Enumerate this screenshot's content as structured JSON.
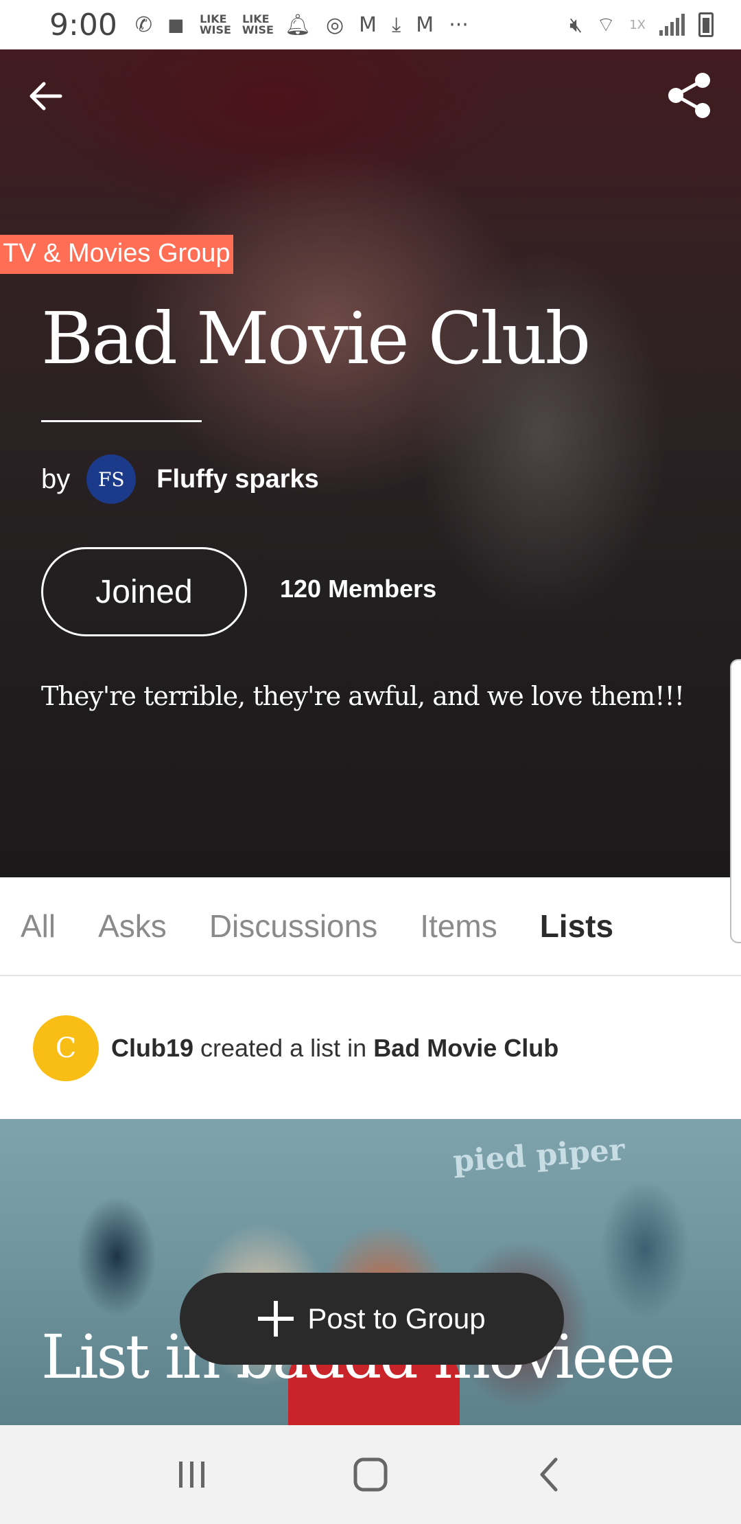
{
  "status_bar": {
    "time": "9:00",
    "left_icons": [
      "wifi-call-icon",
      "bag-icon",
      "like-wise-icon",
      "like-wise-icon",
      "bell-icon",
      "sync-icon",
      "gmail-icon",
      "download-icon",
      "gmail-icon",
      "more-icon"
    ],
    "like_wise_label": "LIKE WISE",
    "more_label": "···",
    "right_icons": [
      "mute-icon",
      "wifi-icon",
      "signal-icon",
      "battery-icon"
    ],
    "speed_label": "1X"
  },
  "hero": {
    "group_tag": "TV & Movies Group",
    "title": "Bad Movie Club",
    "by_label": "by",
    "owner_initials": "FS",
    "owner_name": "Fluffy sparks",
    "joined_label": "Joined",
    "members": "120 Members",
    "description": "They're terrible, they're awful, and we love them!!!"
  },
  "tabs": [
    {
      "label": "All",
      "active": false
    },
    {
      "label": "Asks",
      "active": false
    },
    {
      "label": "Discussions",
      "active": false
    },
    {
      "label": "Items",
      "active": false
    },
    {
      "label": "Lists",
      "active": true
    }
  ],
  "feed": {
    "avatar_initial": "C",
    "user": "Club19",
    "action": "created a list in",
    "group": "Bad Movie Club",
    "card_brand": "pied piper",
    "card_title": "List in baddd movieee"
  },
  "post_button": {
    "label": "Post to Group"
  },
  "colors": {
    "tag_accent": "#ff6e55",
    "owner_avatar": "#1c3a8a",
    "feed_avatar": "#f9be16",
    "post_button": "#2a2a2a"
  }
}
